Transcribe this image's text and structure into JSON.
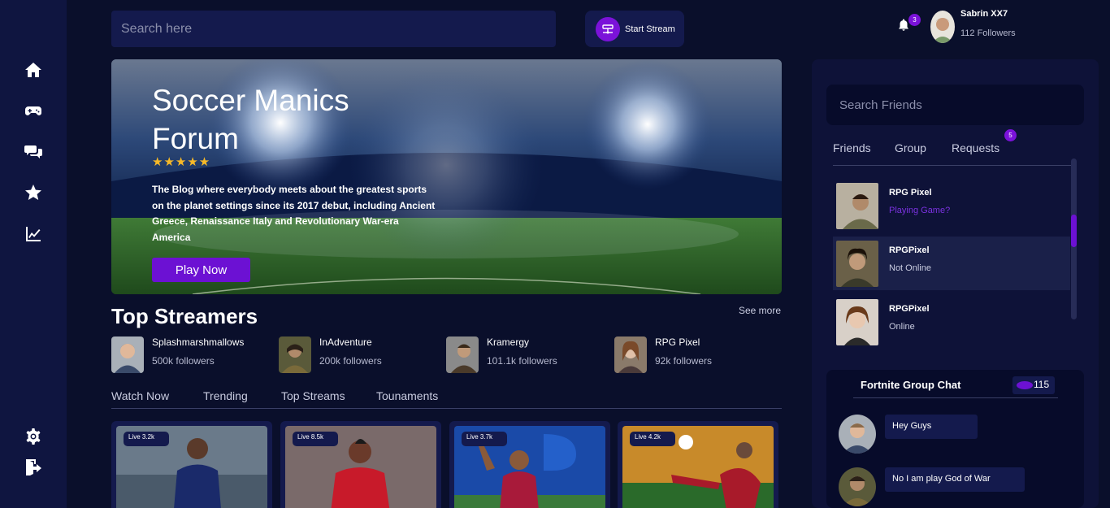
{
  "sidebar": {
    "items": [
      {
        "icon": "home-icon"
      },
      {
        "icon": "gamepad-icon"
      },
      {
        "icon": "chat-icon"
      },
      {
        "icon": "star-icon"
      },
      {
        "icon": "chart-icon"
      }
    ],
    "bottom": [
      {
        "icon": "gear-icon"
      },
      {
        "icon": "logout-icon"
      }
    ]
  },
  "topbar": {
    "search_placeholder": "Search here",
    "stream_label": "Start Stream",
    "notification_count": "3",
    "profile_name": "Sabrin XX7",
    "profile_followers": "112 Followers"
  },
  "hero": {
    "title": "Soccer Manics Forum",
    "stars": "★★★★★",
    "description": "The Blog where everybody meets about the greatest sports on the planet settings since its 2017 debut, including Ancient Greece, Renaissance Italy and Revolutionary War-era America",
    "cta": "Play Now"
  },
  "streamers": {
    "title": "Top Streamers",
    "see_more": "See more",
    "items": [
      {
        "name": "Splashmarshmallows",
        "followers": "500k followers"
      },
      {
        "name": "InAdventure",
        "followers": "200k followers"
      },
      {
        "name": "Kramergy",
        "followers": "101.1k followers"
      },
      {
        "name": "RPG Pixel",
        "followers": "92k followers"
      }
    ]
  },
  "main_tabs": [
    "Watch Now",
    "Trending",
    "Top Streams",
    "Tounaments"
  ],
  "streams": [
    {
      "live": "Live 3.2k"
    },
    {
      "live": "Live 8.5k"
    },
    {
      "live": "Live 3.7k"
    },
    {
      "live": "Live 4.2k"
    }
  ],
  "friends_panel": {
    "search_placeholder": "Search Friends",
    "tabs": [
      "Friends",
      "Group",
      "Requests"
    ],
    "requests_count": "5",
    "friends": [
      {
        "name": "RPG Pixel",
        "status": "Playing Game?"
      },
      {
        "name": "RPGPixel",
        "status": "Not Online"
      },
      {
        "name": "RPGPixel",
        "status": "Online"
      }
    ]
  },
  "chat": {
    "title": "Fortnite Group Chat",
    "count": "115",
    "messages": [
      {
        "text": "Hey Guys"
      },
      {
        "text": "No I am play God of War"
      }
    ]
  },
  "colors": {
    "background": "#0a0f2b",
    "sidebar": "#0f1540",
    "accent": "#6c11d3",
    "panel": "#141a4d"
  }
}
